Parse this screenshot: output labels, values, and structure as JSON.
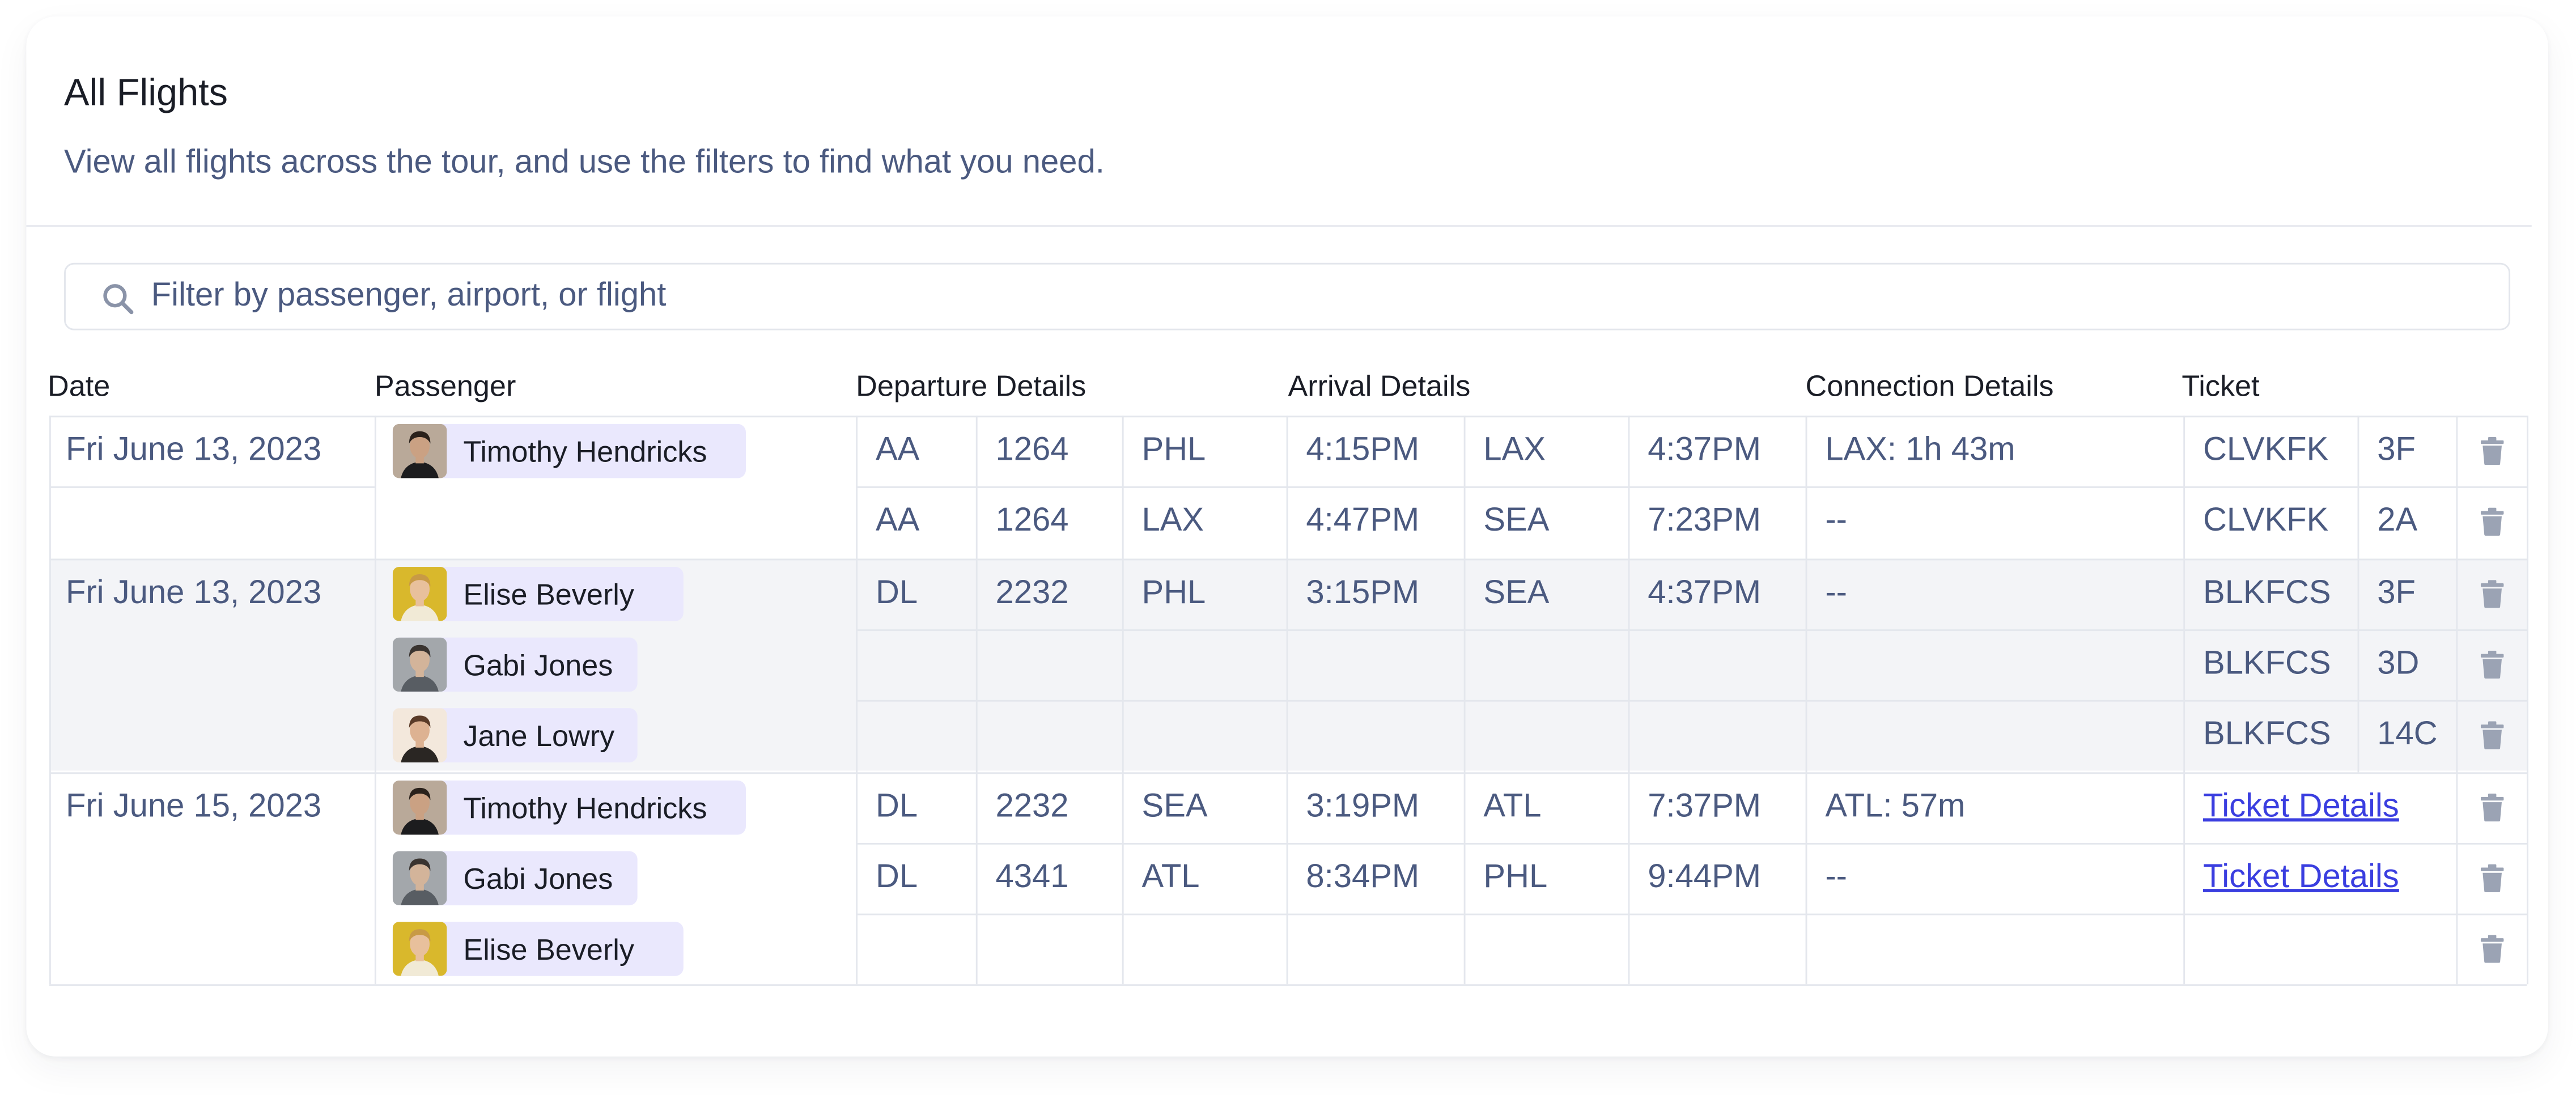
{
  "page": {
    "title": "All Flights",
    "subtitle": "View all flights across the tour, and use the filters to find what you need."
  },
  "search": {
    "placeholder": "Filter by passenger, airport, or flight",
    "value": ""
  },
  "columns": [
    "Date",
    "Passenger",
    "Departure Details",
    "Arrival Details",
    "Connection Details",
    "Ticket"
  ],
  "groups": [
    {
      "date": "Fri June 13, 2023",
      "passengers": [
        "Timothy Hendricks"
      ],
      "rows": [
        {
          "airline": "AA",
          "flight": "1264",
          "from": "PHL",
          "dep": "4:15PM",
          "to": "LAX",
          "arr": "4:37PM",
          "connection": "LAX:  1h 43m",
          "ticket": "CLVKFK",
          "seat": "3F"
        },
        {
          "airline": "AA",
          "flight": "1264",
          "from": "LAX",
          "dep": "4:47PM",
          "to": "SEA",
          "arr": "7:23PM",
          "connection": "--",
          "ticket": "CLVKFK",
          "seat": "2A"
        }
      ]
    },
    {
      "date": "Fri June 13, 2023",
      "passengers": [
        "Elise Beverly",
        "Gabi Jones",
        "Jane Lowry"
      ],
      "rows": [
        {
          "airline": "DL",
          "flight": "2232",
          "from": "PHL",
          "dep": "3:15PM",
          "to": "SEA",
          "arr": "4:37PM",
          "connection": "--",
          "ticket": "BLKFCS",
          "seat": "3F"
        },
        {
          "airline": "",
          "flight": "",
          "from": "",
          "dep": "",
          "to": "",
          "arr": "",
          "connection": "",
          "ticket": "BLKFCS",
          "seat": "3D"
        },
        {
          "airline": "",
          "flight": "",
          "from": "",
          "dep": "",
          "to": "",
          "arr": "",
          "connection": "",
          "ticket": "BLKFCS",
          "seat": "14C"
        }
      ]
    },
    {
      "date": "Fri June 15, 2023",
      "passengers": [
        "Timothy Hendricks",
        "Gabi Jones",
        "Elise Beverly"
      ],
      "rows": [
        {
          "airline": "DL",
          "flight": "2232",
          "from": "SEA",
          "dep": "3:19PM",
          "to": "ATL",
          "arr": "7:37PM",
          "connection": "ATL: 57m",
          "ticket_link": "Ticket Details"
        },
        {
          "airline": "DL",
          "flight": "4341",
          "from": "ATL",
          "dep": "8:34PM",
          "to": "PHL",
          "arr": "9:44PM",
          "connection": "--",
          "ticket_link": "Ticket Details"
        },
        {
          "airline": "",
          "flight": "",
          "from": "",
          "dep": "",
          "to": "",
          "arr": "",
          "connection": "",
          "ticket_link": ""
        }
      ]
    }
  ],
  "colors": {
    "link": "#3a3ee0",
    "pill": "#eae8fd",
    "shaded_row": "#f3f4f7",
    "text": "#4b5a80"
  },
  "icons": {
    "search": "search-icon",
    "delete": "trash-icon"
  }
}
